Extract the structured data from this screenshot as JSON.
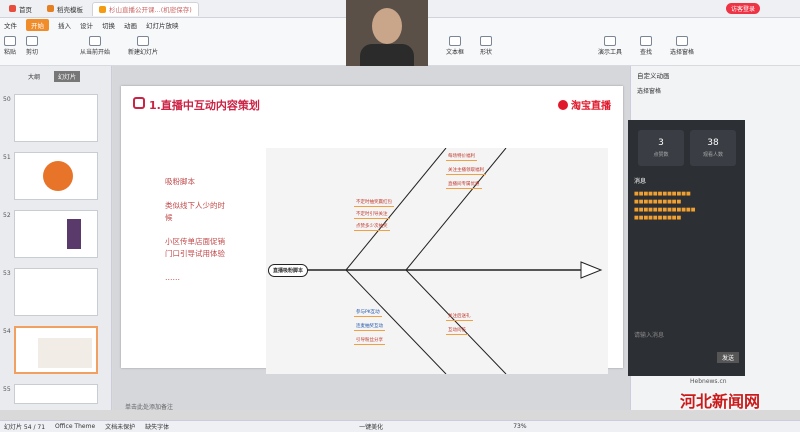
{
  "titlebar": {
    "tabs": [
      "首页",
      "稻壳模板",
      "杉山直播公开课...(机密保存)"
    ],
    "user_btn": "访客登录"
  },
  "menubar": {
    "items": [
      "文件",
      "开始",
      "插入",
      "设计",
      "切换",
      "动画",
      "幻灯片放映",
      "审阅",
      "视图",
      "开发工具",
      "会员专享",
      "稻壳资源"
    ],
    "active": "开始"
  },
  "ribbon": {
    "buttons": [
      "粘贴",
      "剪切",
      "复制",
      "格式刷",
      "从当前开始",
      "新建幻灯片",
      "版式",
      "节",
      "文本框",
      "形状",
      "排列",
      "演示工具",
      "查找",
      "替换",
      "选择窗格"
    ]
  },
  "leftpanel": {
    "tabs": [
      "大纲",
      "幻灯片"
    ],
    "active_tab": "幻灯片",
    "slide_numbers": [
      "50",
      "51",
      "52",
      "53",
      "54",
      "55"
    ],
    "selected": "54"
  },
  "slide": {
    "title": "1.直播中互动内容策划",
    "brand": "淘宝直播",
    "left_text": "吸粉脚本\n\n类似线下人少的时候\n\n小区传单店面促销门口引导试用体验\n\n……",
    "center_node": "直播吸粉脚本",
    "branches_top": [
      "开场互动",
      "福利发放"
    ],
    "branches_bottom": [
      "连麦互动",
      "中奖揭秘"
    ],
    "nodes_top": [
      "不定时抽奖赢红包",
      "不定时引导关注",
      "点赞多少次抽奖",
      "每场特价福利",
      "关注主播领取福利",
      "直播间专属优惠"
    ],
    "nodes_bottom": [
      "参与PK互动",
      "连麦抽奖互动",
      "引导粉丝分享",
      "关注后送礼",
      "互动问答"
    ]
  },
  "notes": {
    "placeholder": "单击此处添加备注"
  },
  "rightpanel": {
    "title": "自定义动画",
    "label": "选择窗格"
  },
  "live": {
    "stat1": "3",
    "stat1_label": "点赞数",
    "stat2": "38",
    "stat2_label": "观看人数",
    "messages_label": "消息",
    "input_placeholder": "请输入消息",
    "send": "发送"
  },
  "statusbar": {
    "slide_info": "幻灯片 54 / 71",
    "theme": "Office Theme",
    "protect": "文档未保护",
    "font": "缺失字体",
    "beautify": "一键美化",
    "zoom": "73%"
  },
  "watermark": "河北新闻网",
  "watermark_url": "Hebnews.cn"
}
